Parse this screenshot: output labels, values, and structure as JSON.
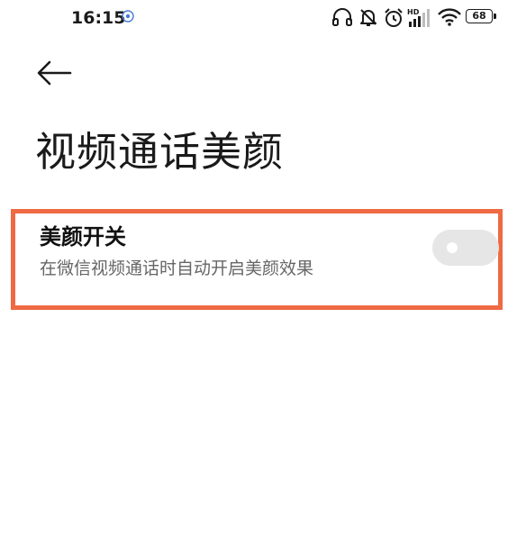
{
  "status_bar": {
    "time": "16:15",
    "battery_level": "68",
    "network_label": "HD",
    "icons": [
      "notification-badge-icon",
      "headphones-icon",
      "bell-muted-icon",
      "alarm-icon",
      "hd-signal-icon",
      "wifi-icon",
      "battery-icon"
    ]
  },
  "header": {
    "back_icon": "back-arrow-icon",
    "title": "视频通话美颜"
  },
  "settings": {
    "beauty_toggle": {
      "title": "美颜开关",
      "description": "在微信视频通话时自动开启美颜效果",
      "enabled": false
    }
  },
  "colors": {
    "highlight_border": "#ef6a44",
    "toggle_off_track": "#e6e6e6",
    "description_text": "#666666"
  }
}
